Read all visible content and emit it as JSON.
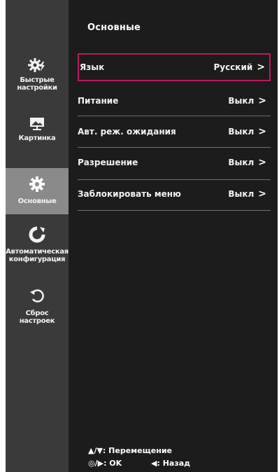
{
  "sidebar": {
    "items": [
      {
        "label": "Быстрые\nнастройки",
        "icon": "quick-settings-gear-lightning-icon"
      },
      {
        "label": "Картинка",
        "icon": "picture-icon"
      },
      {
        "label": "Основные",
        "icon": "gear-icon"
      },
      {
        "label": "Автоматическая\nконфигурация",
        "icon": "auto-config-icon"
      },
      {
        "label": "Сброс\nнастроек",
        "icon": "reset-icon"
      }
    ],
    "active_index": 2
  },
  "main": {
    "title": "Основные",
    "rows": [
      {
        "label": "Язык",
        "value": "Русский"
      },
      {
        "label": "Питание",
        "value": "Выкл"
      },
      {
        "label": "Авт. реж. ожидания",
        "value": "Выкл"
      },
      {
        "label": "Разрешение",
        "value": "Выкл"
      },
      {
        "label": "Заблокировать меню",
        "value": "Выкл"
      }
    ],
    "selected_index": 0
  },
  "hints": {
    "move": "▲/▼: Перемещение",
    "ok": "◎/▶: OK",
    "back": "◀: Назад"
  },
  "colors": {
    "sidebar_bg": "#3a3a3a",
    "sidebar_active_bg": "#8a8a8a",
    "main_bg": "#1c1c1c",
    "selection_border": "#c0185c"
  }
}
